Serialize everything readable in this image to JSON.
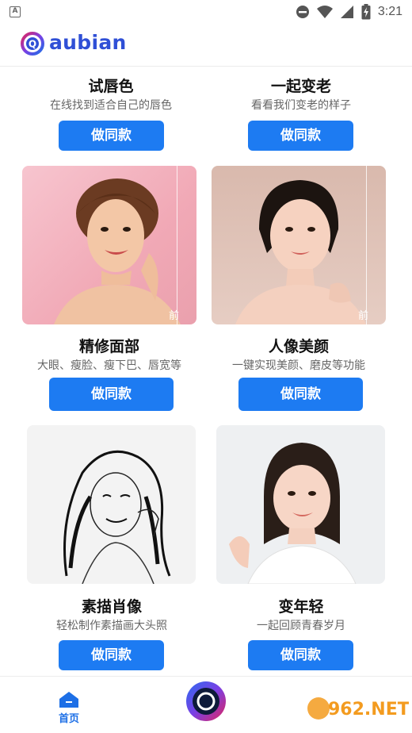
{
  "status_bar": {
    "notification_icon": "a-icon",
    "time": "3:21"
  },
  "header": {
    "logo_letter": "Q",
    "logo_text": "aubian"
  },
  "cards": [
    {
      "title": "试唇色",
      "subtitle": "在线找到适合自己的唇色",
      "button": "做同款"
    },
    {
      "title": "一起变老",
      "subtitle": "看看我们变老的样子",
      "button": "做同款"
    },
    {
      "title": "精修面部",
      "subtitle": "大眼、瘦脸、瘦下巴、唇宽等",
      "button": "做同款",
      "compare_label": "前"
    },
    {
      "title": "人像美颜",
      "subtitle": "一键实现美颜、磨皮等功能",
      "button": "做同款",
      "compare_label": "前"
    },
    {
      "title": "素描肖像",
      "subtitle": "轻松制作素描画大头照",
      "button": "做同款"
    },
    {
      "title": "变年轻",
      "subtitle": "一起回顾青春岁月",
      "button": "做同款"
    }
  ],
  "bottom_nav": {
    "home_label": "首页",
    "watermark": "962.NET"
  },
  "colors": {
    "accent": "#1d7bf2",
    "logo": "#2f4fd6",
    "nav_active": "#1d6fe6"
  }
}
